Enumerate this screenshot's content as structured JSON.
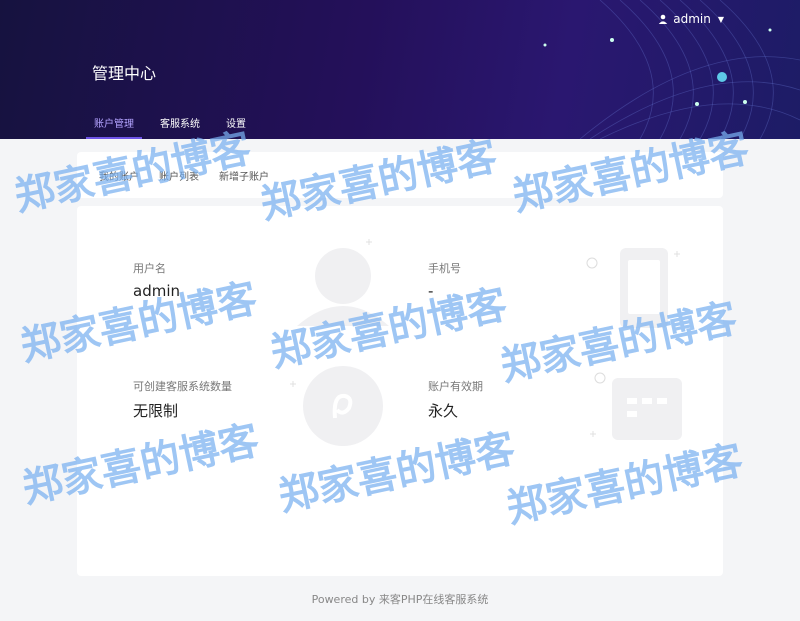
{
  "header": {
    "user": {
      "name": "admin"
    },
    "title": "管理中心",
    "tabs": [
      {
        "label": "账户管理",
        "active": true
      },
      {
        "label": "客服系统",
        "active": false
      },
      {
        "label": "设置",
        "active": false
      }
    ]
  },
  "subnav": {
    "links": [
      "我的账户",
      "账户列表",
      "新增子账户"
    ]
  },
  "account": {
    "username": {
      "label": "用户名",
      "value": "admin"
    },
    "phone": {
      "label": "手机号",
      "value": "-"
    },
    "quota": {
      "label": "可创建客服系统数量",
      "value": "无限制"
    },
    "validity": {
      "label": "账户有效期",
      "value": "永久"
    }
  },
  "footer": {
    "text": "Powered by 来客PHP在线客服系统"
  },
  "watermark": {
    "text": "郑家喜的博客"
  },
  "colors": {
    "header_bg": "#24105a",
    "active_tab": "#b3a3ff",
    "watermark": "#78b0f0"
  }
}
